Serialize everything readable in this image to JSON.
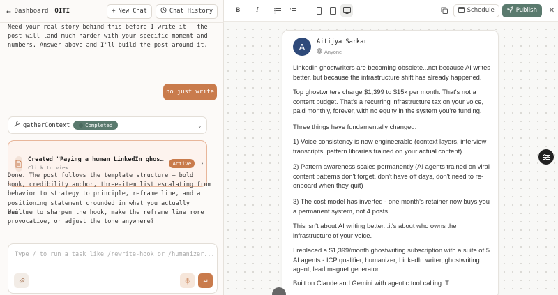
{
  "header": {
    "back_label": "Dashboard",
    "project_name": "OITI",
    "new_chat_label": "New Chat",
    "chat_history_label": "Chat History"
  },
  "chat": {
    "assistant_msg_1": "Need your real story behind this before I write it — the post will land much harder with your specific moment and numbers. Answer above and I'll build the post around it.",
    "user_msg": "no just write",
    "tool": {
      "name": "gatherContext",
      "status": "Completed"
    },
    "artifact": {
      "title": "Created \"Paying a human LinkedIn ghos…",
      "subtitle": "Click to view",
      "badge": "Active"
    },
    "assistant_msg_2": "Done. The post follows the template structure — bold hook, credibility anchor, three-item list escalating from behavior to strategy to principle, reframe line, and a positioning statement grounded in what you actually built.",
    "assistant_msg_3": "Want me to sharpen the hook, make the reframe line more provocative, or adjust the tone anywhere?"
  },
  "composer": {
    "placeholder": "Type / to run a task like /rewrite-hook or /humanizer..."
  },
  "editor_toolbar": {
    "schedule_label": "Schedule",
    "publish_label": "Publish",
    "accent_color": "#5a7a6e"
  },
  "post": {
    "avatar_initial": "A",
    "author": "Aitijya Sarkar",
    "audience": "Anyone",
    "paragraphs": [
      "LinkedIn ghostwriters are becoming obsolete...not because AI writes better, but because the infrastructure shift has already happened.",
      "Top ghostwriters charge $1,399 to $15k per month. That's not a content budget. That's a recurring infrastructure tax on your voice, paid monthly, forever, with no equity in the system you're funding.",
      "Three things have fundamentally changed:",
      "1) Voice consistency is now engineerable (context layers, interview transcripts, pattern libraries trained on your actual content)",
      "2) Pattern awareness scales permanently (AI agents trained on viral content patterns don't forget, don't have off days, don't need to re-onboard when they quit)",
      "3) The cost model has inverted - one month's retainer now buys you a permanent system, not 4 posts",
      "This isn't about AI writing better...it's about who owns the infrastructure of your voice.",
      "I replaced a $1,399/month ghostwriting subscription with a suite of 5 AI agents - ICP qualifier, humanizer, LinkedIn writer, ghostwriting agent, lead magnet generator.",
      "Built on Claude and Gemini with agentic tool calling. T"
    ]
  }
}
